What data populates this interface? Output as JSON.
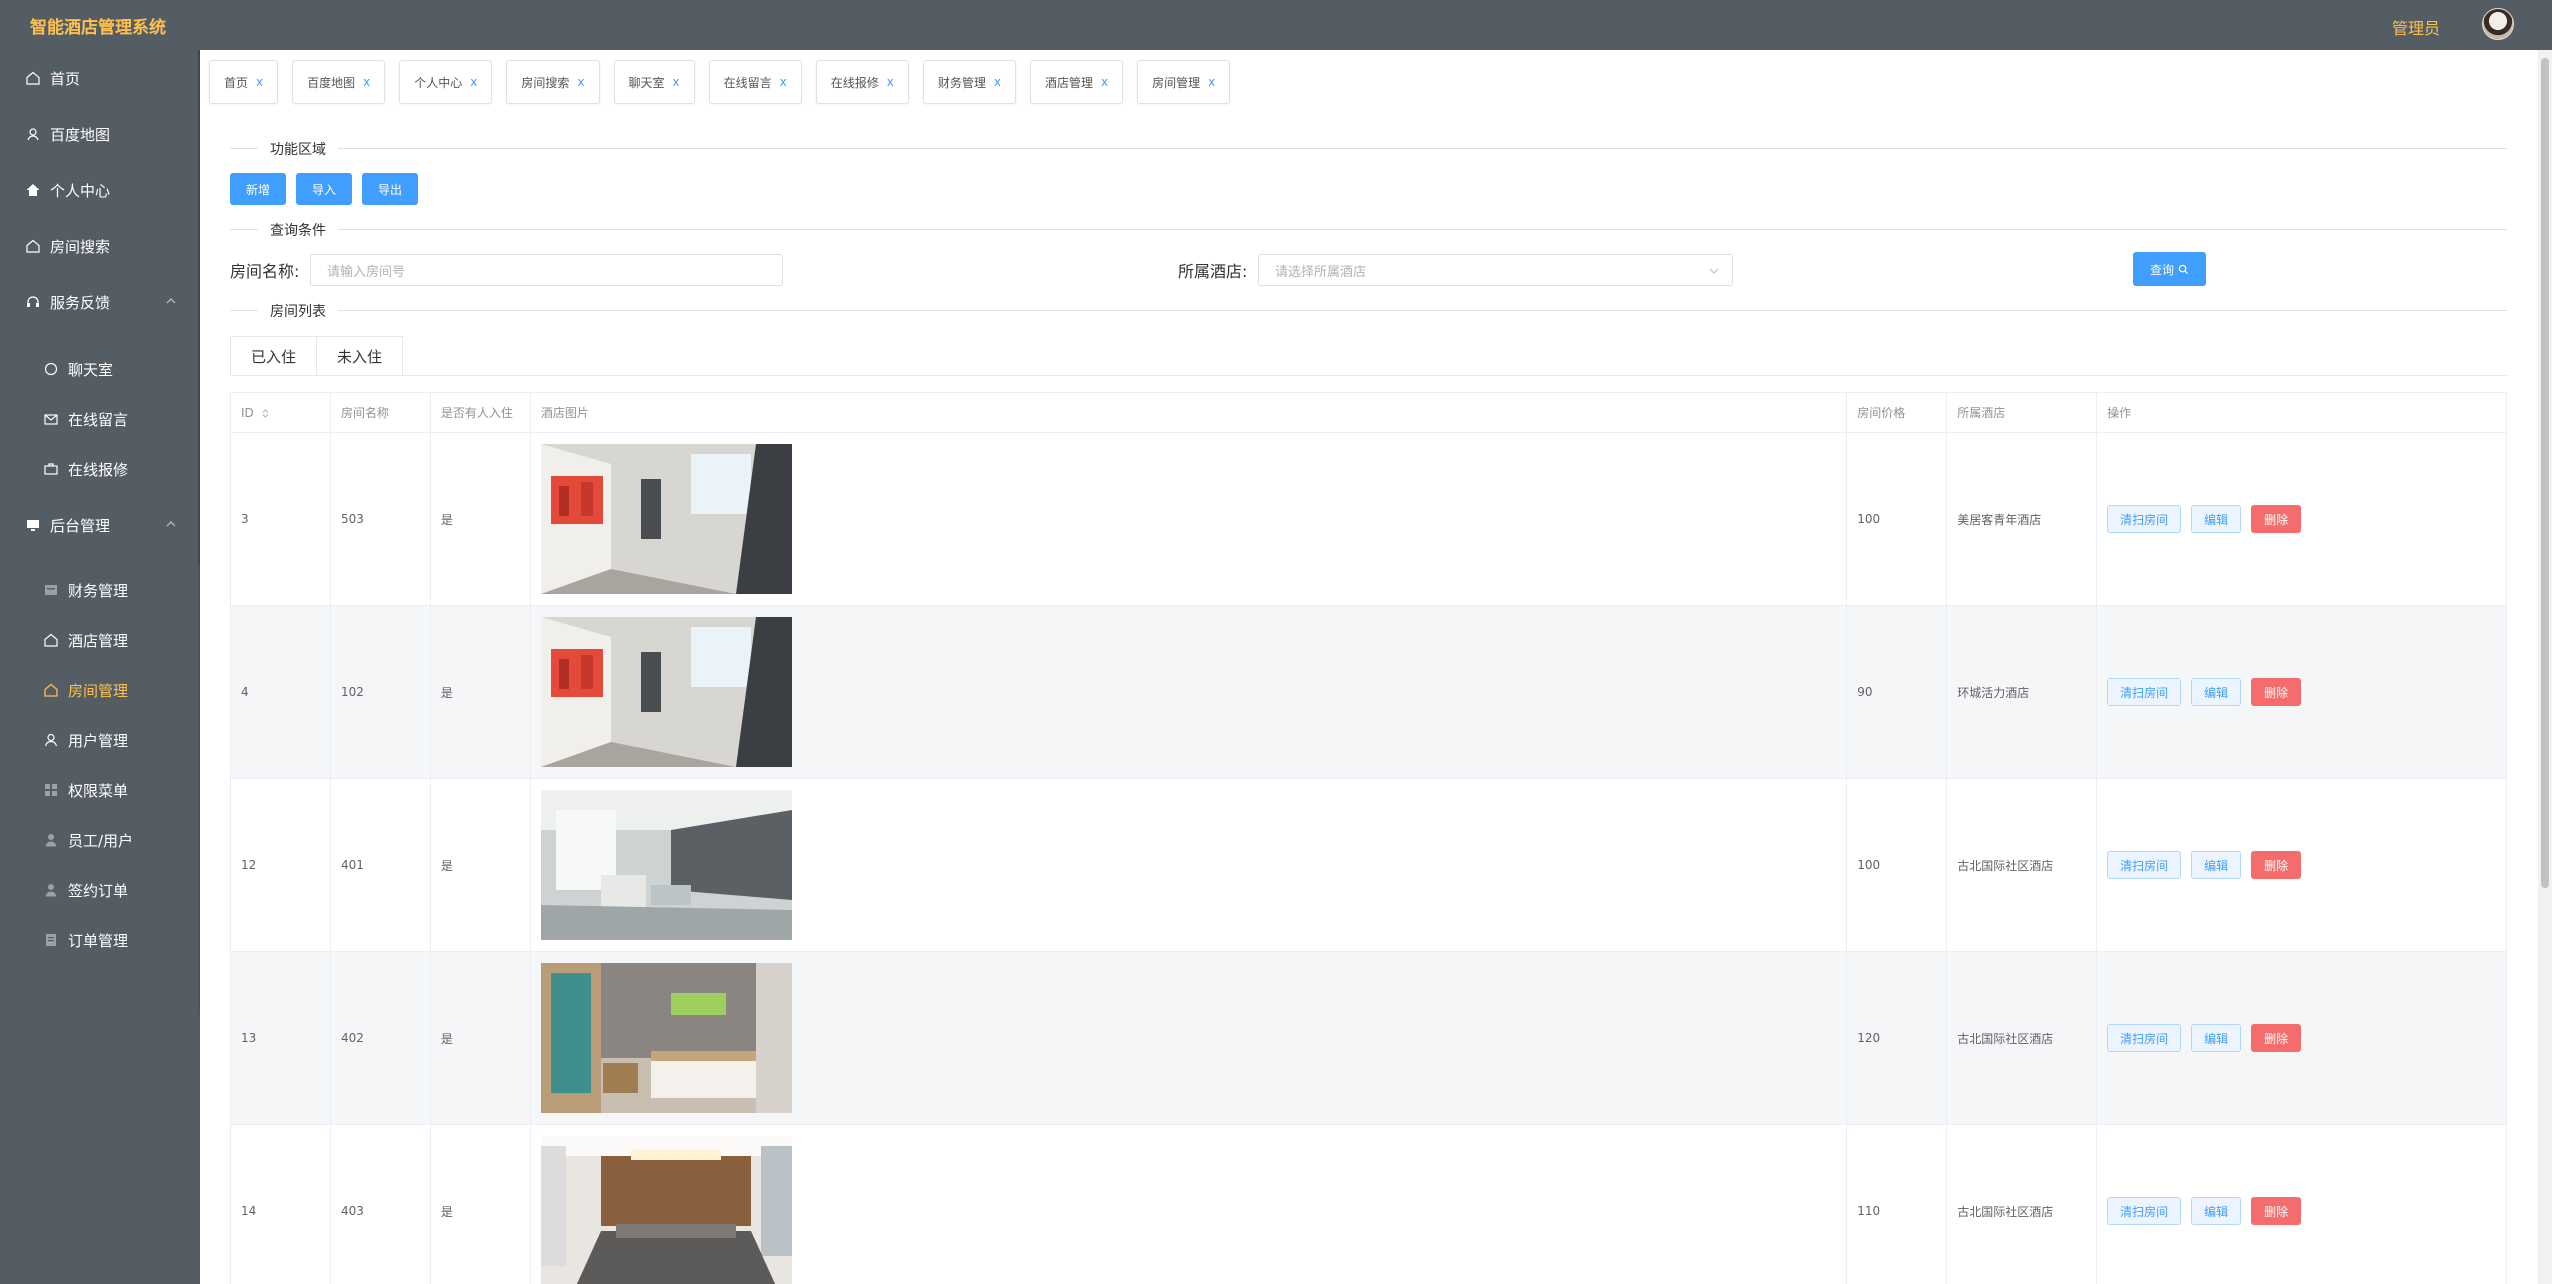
{
  "app": {
    "title": "智能酒店管理系统",
    "user_label": "管理员"
  },
  "colors": {
    "sidebar_bg": "#545c64",
    "accent": "#ffc04d",
    "primary": "#409eff",
    "danger": "#f56c6c"
  },
  "sidebar": {
    "items": [
      {
        "label": "首页",
        "icon": "home-icon"
      },
      {
        "label": "百度地图",
        "icon": "map-pin-icon"
      },
      {
        "label": "个人中心",
        "icon": "house-icon"
      },
      {
        "label": "房间搜索",
        "icon": "home-icon"
      },
      {
        "label": "服务反馈",
        "icon": "headset-icon",
        "expanded": true
      },
      {
        "label": "聊天室",
        "icon": "chat-icon"
      },
      {
        "label": "在线留言",
        "icon": "mail-icon"
      },
      {
        "label": "在线报修",
        "icon": "briefcase-icon"
      },
      {
        "label": "后台管理",
        "icon": "monitor-icon",
        "expanded": true
      },
      {
        "label": "财务管理",
        "icon": "wallet-icon"
      },
      {
        "label": "酒店管理",
        "icon": "home-icon"
      },
      {
        "label": "房间管理",
        "icon": "home-icon",
        "active": true
      },
      {
        "label": "用户管理",
        "icon": "user-icon"
      },
      {
        "label": "权限菜单",
        "icon": "grid-icon"
      },
      {
        "label": "员工/用户",
        "icon": "user-solid-icon"
      },
      {
        "label": "签约订单",
        "icon": "user-solid-icon"
      },
      {
        "label": "订单管理",
        "icon": "document-icon"
      }
    ]
  },
  "tabs": [
    {
      "label": "首页",
      "close": "x"
    },
    {
      "label": "百度地图",
      "close": "x"
    },
    {
      "label": "个人中心",
      "close": "x"
    },
    {
      "label": "房间搜索",
      "close": "x"
    },
    {
      "label": "聊天室",
      "close": "x"
    },
    {
      "label": "在线留言",
      "close": "x"
    },
    {
      "label": "在线报修",
      "close": "x"
    },
    {
      "label": "财务管理",
      "close": "x"
    },
    {
      "label": "酒店管理",
      "close": "x"
    },
    {
      "label": "房间管理",
      "close": "x"
    }
  ],
  "sections": {
    "functions": "功能区域",
    "query": "查询条件",
    "list": "房间列表"
  },
  "actions": {
    "add": "新增",
    "import": "导入",
    "export": "导出"
  },
  "query": {
    "room_name_label": "房间名称:",
    "room_name_placeholder": "请输入房间号",
    "hotel_label": "所属酒店:",
    "hotel_placeholder": "请选择所属酒店",
    "search_button": "查询"
  },
  "subtabs": [
    "已入住",
    "未入住"
  ],
  "table": {
    "headers": [
      "ID",
      "房间名称",
      "是否有人入住",
      "酒店图片",
      "房间价格",
      "所属酒店",
      "操作"
    ],
    "row_actions": {
      "clean": "清扫房间",
      "edit": "编辑",
      "delete": "删除"
    },
    "rows": [
      {
        "id": "3",
        "name": "503",
        "occupied": "是",
        "image": "room-photo-1",
        "price": "100",
        "hotel": "美居客青年酒店"
      },
      {
        "id": "4",
        "name": "102",
        "occupied": "是",
        "image": "room-photo-1",
        "price": "90",
        "hotel": "环城活力酒店"
      },
      {
        "id": "12",
        "name": "401",
        "occupied": "是",
        "image": "room-photo-2",
        "price": "100",
        "hotel": "古北国际社区酒店"
      },
      {
        "id": "13",
        "name": "402",
        "occupied": "是",
        "image": "room-photo-3",
        "price": "120",
        "hotel": "古北国际社区酒店"
      },
      {
        "id": "14",
        "name": "403",
        "occupied": "是",
        "image": "room-photo-4",
        "price": "110",
        "hotel": "古北国际社区酒店"
      }
    ]
  }
}
